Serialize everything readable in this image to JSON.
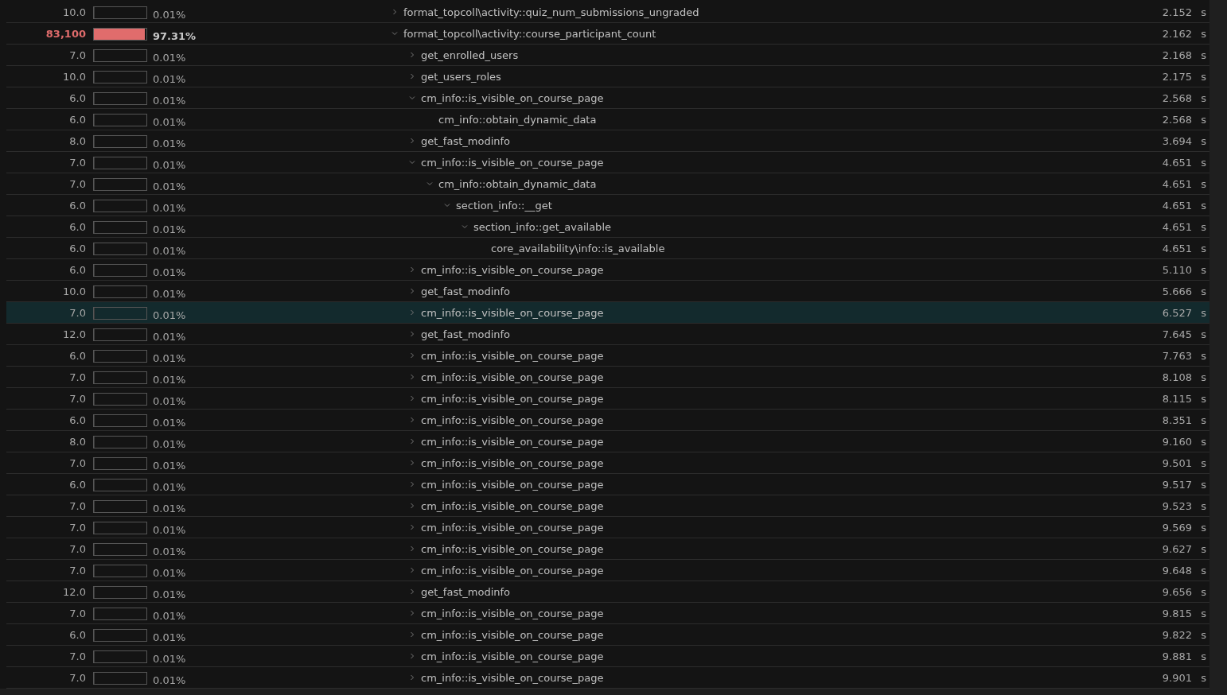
{
  "rows": [
    {
      "count": "10.0",
      "level": 0.0001,
      "percent": "0.01%",
      "name": "format_topcoll\\activity::quiz_num_submissions_ungraded",
      "time": "2.152",
      "unit": "s",
      "kind": "branch",
      "expanded": false,
      "hot": false,
      "selected": false
    },
    {
      "count": "83,100",
      "level": 0.9731,
      "percent": "97.31%",
      "name": "format_topcoll\\activity::course_participant_count",
      "time": "2.162",
      "unit": "s",
      "kind": "branch",
      "expanded": true,
      "hot": true,
      "selected": false,
      "children": [
        {
          "count": "7.0",
          "level": 0.0001,
          "percent": "0.01%",
          "name": "get_enrolled_users",
          "time": "2.168",
          "unit": "s",
          "kind": "branch",
          "expanded": false,
          "hot": false,
          "selected": false
        },
        {
          "count": "10.0",
          "level": 0.0001,
          "percent": "0.01%",
          "name": "get_users_roles",
          "time": "2.175",
          "unit": "s",
          "kind": "branch",
          "expanded": false,
          "hot": false,
          "selected": false
        },
        {
          "count": "6.0",
          "level": 0.0001,
          "percent": "0.01%",
          "name": "cm_info::is_visible_on_course_page",
          "time": "2.568",
          "unit": "s",
          "kind": "branch",
          "expanded": true,
          "hot": false,
          "selected": false,
          "children": [
            {
              "count": "6.0",
              "level": 0.0001,
              "percent": "0.01%",
              "name": "cm_info::obtain_dynamic_data",
              "time": "2.568",
              "unit": "s",
              "kind": "leaf",
              "hot": false,
              "selected": false
            }
          ]
        },
        {
          "count": "8.0",
          "level": 0.0001,
          "percent": "0.01%",
          "name": "get_fast_modinfo",
          "time": "3.694",
          "unit": "s",
          "kind": "branch",
          "expanded": false,
          "hot": false,
          "selected": false
        },
        {
          "count": "7.0",
          "level": 0.0001,
          "percent": "0.01%",
          "name": "cm_info::is_visible_on_course_page",
          "time": "4.651",
          "unit": "s",
          "kind": "branch",
          "expanded": true,
          "hot": false,
          "selected": false,
          "children": [
            {
              "count": "7.0",
              "level": 0.0001,
              "percent": "0.01%",
              "name": "cm_info::obtain_dynamic_data",
              "time": "4.651",
              "unit": "s",
              "kind": "branch",
              "expanded": true,
              "hot": false,
              "selected": false,
              "children": [
                {
                  "count": "6.0",
                  "level": 0.0001,
                  "percent": "0.01%",
                  "name": "section_info::__get",
                  "time": "4.651",
                  "unit": "s",
                  "kind": "branch",
                  "expanded": true,
                  "hot": false,
                  "selected": false,
                  "children": [
                    {
                      "count": "6.0",
                      "level": 0.0001,
                      "percent": "0.01%",
                      "name": "section_info::get_available",
                      "time": "4.651",
                      "unit": "s",
                      "kind": "branch",
                      "expanded": true,
                      "hot": false,
                      "selected": false,
                      "children": [
                        {
                          "count": "6.0",
                          "level": 0.0001,
                          "percent": "0.01%",
                          "name": "core_availability\\info::is_available",
                          "time": "4.651",
                          "unit": "s",
                          "kind": "leaf",
                          "hot": false,
                          "selected": false
                        }
                      ]
                    }
                  ]
                }
              ]
            }
          ]
        },
        {
          "count": "6.0",
          "level": 0.0001,
          "percent": "0.01%",
          "name": "cm_info::is_visible_on_course_page",
          "time": "5.110",
          "unit": "s",
          "kind": "branch",
          "expanded": false,
          "hot": false,
          "selected": false
        },
        {
          "count": "10.0",
          "level": 0.0001,
          "percent": "0.01%",
          "name": "get_fast_modinfo",
          "time": "5.666",
          "unit": "s",
          "kind": "branch",
          "expanded": false,
          "hot": false,
          "selected": false
        },
        {
          "count": "7.0",
          "level": 0.0001,
          "percent": "0.01%",
          "name": "cm_info::is_visible_on_course_page",
          "time": "6.527",
          "unit": "s",
          "kind": "branch",
          "expanded": false,
          "hot": false,
          "selected": true
        },
        {
          "count": "12.0",
          "level": 0.0001,
          "percent": "0.01%",
          "name": "get_fast_modinfo",
          "time": "7.645",
          "unit": "s",
          "kind": "branch",
          "expanded": false,
          "hot": false,
          "selected": false
        },
        {
          "count": "6.0",
          "level": 0.0001,
          "percent": "0.01%",
          "name": "cm_info::is_visible_on_course_page",
          "time": "7.763",
          "unit": "s",
          "kind": "branch",
          "expanded": false,
          "hot": false,
          "selected": false
        },
        {
          "count": "7.0",
          "level": 0.0001,
          "percent": "0.01%",
          "name": "cm_info::is_visible_on_course_page",
          "time": "8.108",
          "unit": "s",
          "kind": "branch",
          "expanded": false,
          "hot": false,
          "selected": false
        },
        {
          "count": "7.0",
          "level": 0.0001,
          "percent": "0.01%",
          "name": "cm_info::is_visible_on_course_page",
          "time": "8.115",
          "unit": "s",
          "kind": "branch",
          "expanded": false,
          "hot": false,
          "selected": false
        },
        {
          "count": "6.0",
          "level": 0.0001,
          "percent": "0.01%",
          "name": "cm_info::is_visible_on_course_page",
          "time": "8.351",
          "unit": "s",
          "kind": "branch",
          "expanded": false,
          "hot": false,
          "selected": false
        },
        {
          "count": "8.0",
          "level": 0.0001,
          "percent": "0.01%",
          "name": "cm_info::is_visible_on_course_page",
          "time": "9.160",
          "unit": "s",
          "kind": "branch",
          "expanded": false,
          "hot": false,
          "selected": false
        },
        {
          "count": "7.0",
          "level": 0.0001,
          "percent": "0.01%",
          "name": "cm_info::is_visible_on_course_page",
          "time": "9.501",
          "unit": "s",
          "kind": "branch",
          "expanded": false,
          "hot": false,
          "selected": false
        },
        {
          "count": "6.0",
          "level": 0.0001,
          "percent": "0.01%",
          "name": "cm_info::is_visible_on_course_page",
          "time": "9.517",
          "unit": "s",
          "kind": "branch",
          "expanded": false,
          "hot": false,
          "selected": false
        },
        {
          "count": "7.0",
          "level": 0.0001,
          "percent": "0.01%",
          "name": "cm_info::is_visible_on_course_page",
          "time": "9.523",
          "unit": "s",
          "kind": "branch",
          "expanded": false,
          "hot": false,
          "selected": false
        },
        {
          "count": "7.0",
          "level": 0.0001,
          "percent": "0.01%",
          "name": "cm_info::is_visible_on_course_page",
          "time": "9.569",
          "unit": "s",
          "kind": "branch",
          "expanded": false,
          "hot": false,
          "selected": false
        },
        {
          "count": "7.0",
          "level": 0.0001,
          "percent": "0.01%",
          "name": "cm_info::is_visible_on_course_page",
          "time": "9.627",
          "unit": "s",
          "kind": "branch",
          "expanded": false,
          "hot": false,
          "selected": false
        },
        {
          "count": "7.0",
          "level": 0.0001,
          "percent": "0.01%",
          "name": "cm_info::is_visible_on_course_page",
          "time": "9.648",
          "unit": "s",
          "kind": "branch",
          "expanded": false,
          "hot": false,
          "selected": false
        },
        {
          "count": "12.0",
          "level": 0.0001,
          "percent": "0.01%",
          "name": "get_fast_modinfo",
          "time": "9.656",
          "unit": "s",
          "kind": "branch",
          "expanded": false,
          "hot": false,
          "selected": false
        },
        {
          "count": "7.0",
          "level": 0.0001,
          "percent": "0.01%",
          "name": "cm_info::is_visible_on_course_page",
          "time": "9.815",
          "unit": "s",
          "kind": "branch",
          "expanded": false,
          "hot": false,
          "selected": false
        },
        {
          "count": "6.0",
          "level": 0.0001,
          "percent": "0.01%",
          "name": "cm_info::is_visible_on_course_page",
          "time": "9.822",
          "unit": "s",
          "kind": "branch",
          "expanded": false,
          "hot": false,
          "selected": false
        },
        {
          "count": "7.0",
          "level": 0.0001,
          "percent": "0.01%",
          "name": "cm_info::is_visible_on_course_page",
          "time": "9.881",
          "unit": "s",
          "kind": "branch",
          "expanded": false,
          "hot": false,
          "selected": false
        },
        {
          "count": "7.0",
          "level": 0.0001,
          "percent": "0.01%",
          "name": "cm_info::is_visible_on_course_page",
          "time": "9.901",
          "unit": "s",
          "kind": "branch",
          "expanded": false,
          "hot": false,
          "selected": false
        }
      ]
    }
  ]
}
